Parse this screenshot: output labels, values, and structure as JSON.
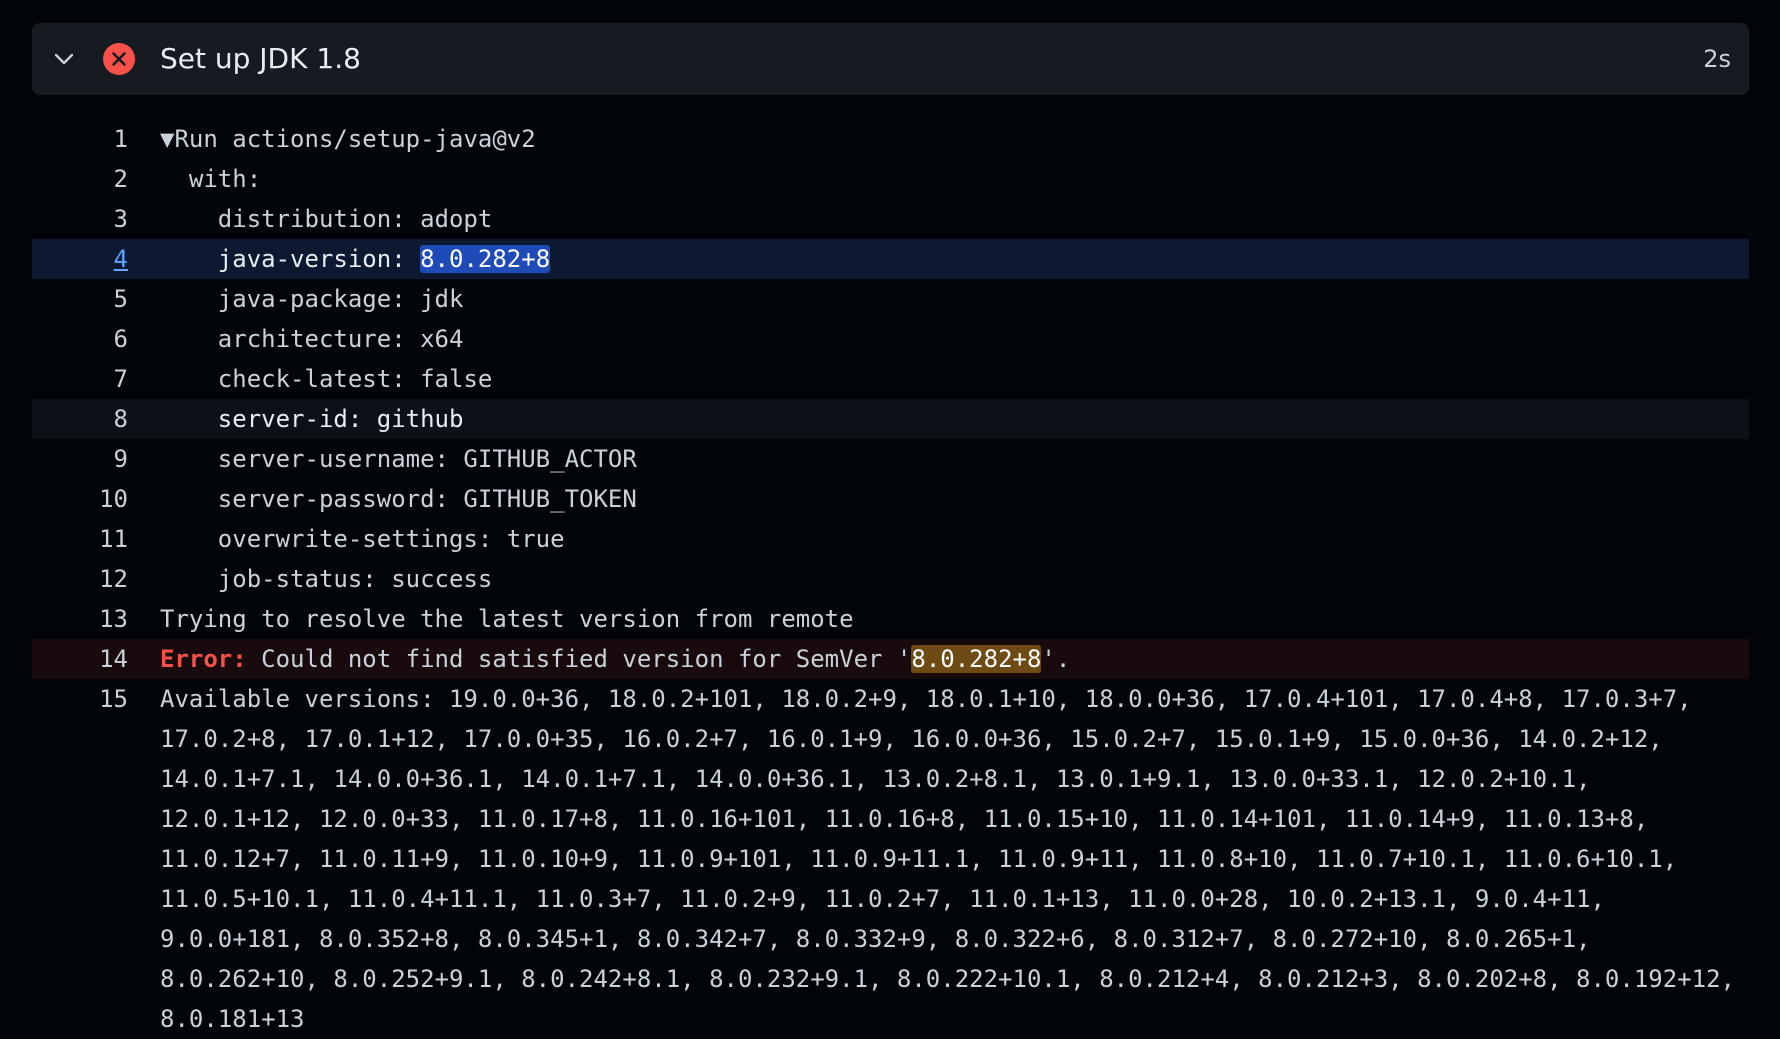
{
  "step": {
    "title": "Set up JDK 1.8",
    "duration": "2s",
    "status": "failed",
    "status_icon": "x-circle-icon",
    "toggle_icon": "chevron-down-icon"
  },
  "colors": {
    "error_red": "#f85149",
    "selected_bg": "#0d1930",
    "error_bg": "#190b0d",
    "highlight_blue": "#1f4bb8",
    "highlight_amber": "#6e4a14",
    "link_blue": "#58a6ff"
  },
  "log": {
    "lines": [
      {
        "num": "1",
        "toggle": "▼",
        "text": "Run actions/setup-java@v2"
      },
      {
        "num": "2",
        "text": "  with:"
      },
      {
        "num": "3",
        "text": "    distribution: adopt"
      },
      {
        "num": "4",
        "prefix": "    java-version: ",
        "highlight": "8.0.282+8"
      },
      {
        "num": "5",
        "text": "    java-package: jdk"
      },
      {
        "num": "6",
        "text": "    architecture: x64"
      },
      {
        "num": "7",
        "text": "    check-latest: false"
      },
      {
        "num": "8",
        "text": "    server-id: github"
      },
      {
        "num": "9",
        "text": "    server-username: GITHUB_ACTOR"
      },
      {
        "num": "10",
        "text": "    server-password: GITHUB_TOKEN"
      },
      {
        "num": "11",
        "text": "    overwrite-settings: true"
      },
      {
        "num": "12",
        "text": "    job-status: success"
      },
      {
        "num": "13",
        "text": "Trying to resolve the latest version from remote"
      },
      {
        "num": "14",
        "error_label": "Error:",
        "prefix": " Could not find satisfied version for SemVer '",
        "highlight": "8.0.282+8",
        "suffix": "'."
      },
      {
        "num": "15",
        "text": "Available versions: 19.0.0+36, 18.0.2+101, 18.0.2+9, 18.0.1+10, 18.0.0+36, 17.0.4+101, 17.0.4+8, 17.0.3+7, 17.0.2+8, 17.0.1+12, 17.0.0+35, 16.0.2+7, 16.0.1+9, 16.0.0+36, 15.0.2+7, 15.0.1+9, 15.0.0+36, 14.0.2+12, 14.0.1+7.1, 14.0.0+36.1, 14.0.1+7.1, 14.0.0+36.1, 13.0.2+8.1, 13.0.1+9.1, 13.0.0+33.1, 12.0.2+10.1, 12.0.1+12, 12.0.0+33, 11.0.17+8, 11.0.16+101, 11.0.16+8, 11.0.15+10, 11.0.14+101, 11.0.14+9, 11.0.13+8, 11.0.12+7, 11.0.11+9, 11.0.10+9, 11.0.9+101, 11.0.9+11.1, 11.0.9+11, 11.0.8+10, 11.0.7+10.1, 11.0.6+10.1, 11.0.5+10.1, 11.0.4+11.1, 11.0.3+7, 11.0.2+9, 11.0.2+7, 11.0.1+13, 11.0.0+28, 10.0.2+13.1, 9.0.4+11, 9.0.0+181, 8.0.352+8, 8.0.345+1, 8.0.342+7, 8.0.332+9, 8.0.322+6, 8.0.312+7, 8.0.272+10, 8.0.265+1, 8.0.262+10, 8.0.252+9.1, 8.0.242+8.1, 8.0.232+9.1, 8.0.222+10.1, 8.0.212+4, 8.0.212+3, 8.0.202+8, 8.0.192+12, 8.0.181+13"
      }
    ]
  }
}
